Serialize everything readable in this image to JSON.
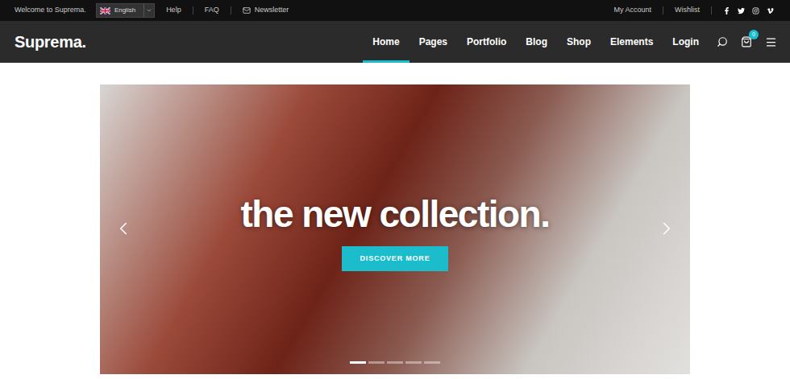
{
  "topbar": {
    "welcome": "Welcome to Suprema.",
    "language": "English",
    "links": [
      {
        "label": "Help",
        "kind": "text"
      },
      {
        "label": "FAQ",
        "kind": "text"
      },
      {
        "label": "Newsletter",
        "kind": "mail"
      }
    ],
    "account_links": [
      "My Account",
      "Wishlist"
    ]
  },
  "header": {
    "logo": "Suprema.",
    "nav": [
      {
        "label": "Home",
        "selected": true
      },
      {
        "label": "Pages",
        "selected": false
      },
      {
        "label": "Portfolio",
        "selected": false
      },
      {
        "label": "Blog",
        "selected": false
      },
      {
        "label": "Shop",
        "selected": false
      },
      {
        "label": "Elements",
        "selected": false
      },
      {
        "label": "Login",
        "selected": false
      }
    ],
    "cart_count": "0"
  },
  "slider": {
    "heading": "the new collection.",
    "button": "DISCOVER MORE",
    "dots": [
      {
        "selected": true
      },
      {
        "selected": false
      },
      {
        "selected": false
      },
      {
        "selected": false
      },
      {
        "selected": false
      }
    ]
  }
}
